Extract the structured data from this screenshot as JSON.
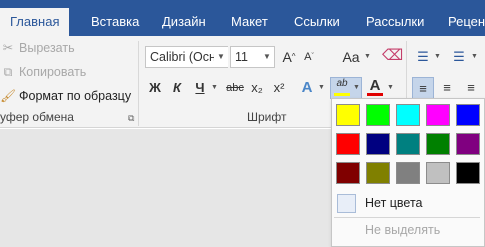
{
  "tabs": [
    {
      "label": "Главная",
      "active": true
    },
    {
      "label": "Вставка"
    },
    {
      "label": "Дизайн"
    },
    {
      "label": "Макет"
    },
    {
      "label": "Ссылки"
    },
    {
      "label": "Рассылки"
    },
    {
      "label": "Реценз"
    }
  ],
  "clipboard": {
    "cut": "Вырезать",
    "copy": "Копировать",
    "format_painter": "Формат по образцу",
    "group_label": "уфер обмена"
  },
  "font": {
    "font_name": "Calibri (Осно",
    "font_size": "11",
    "group_label": "Шрифт",
    "bold": "Ж",
    "italic": "К",
    "underline": "Ч",
    "strike": "abc",
    "subscript": "x₂",
    "superscript": "x²",
    "change_case": "Aa",
    "text_effects": "A",
    "highlight_label": "ab",
    "font_color": "A"
  },
  "highlight_menu": {
    "colors": [
      [
        "#ffff00",
        "#00ff00",
        "#00ffff",
        "#ff00ff",
        "#0000ff"
      ],
      [
        "#ff0000",
        "#000080",
        "#008080",
        "#008000",
        "#800080"
      ],
      [
        "#800000",
        "#808000",
        "#808080",
        "#c0c0c0",
        "#000000"
      ]
    ],
    "no_color": "Нет цвета",
    "stop_highlighting": "Не выделять"
  },
  "accent": "#2b579a"
}
